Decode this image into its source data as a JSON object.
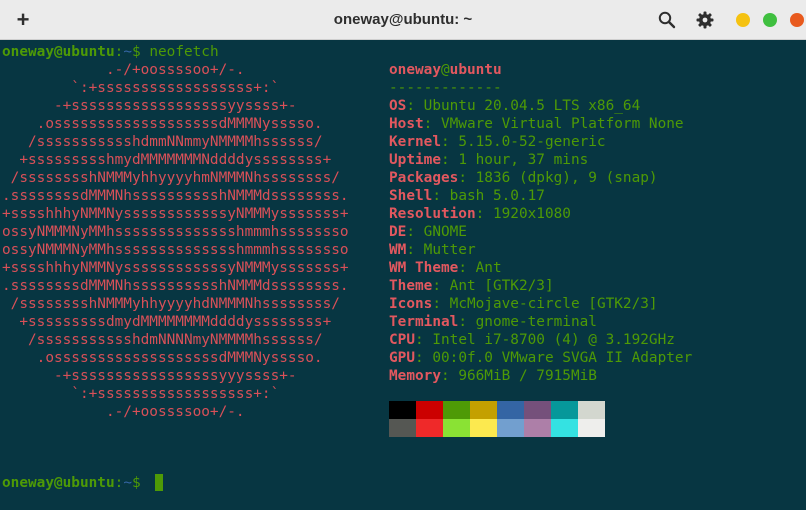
{
  "window": {
    "title": "oneway@ubuntu: ~",
    "new_tab": "+"
  },
  "colors": {
    "close": "#e85a1e",
    "maximize": "#3fbf3f",
    "minimize": "#f5c211",
    "background": "#073642"
  },
  "prompt": {
    "user_host": "oneway@ubuntu",
    "separator": ":",
    "path": "~",
    "symbol": "$",
    "command": "neofetch"
  },
  "logo": [
    "            .-/+oossssoo+/-.",
    "        `:+ssssssssssssssssss+:`",
    "      -+ssssssssssssssssssyyssss+-",
    "    .osssssssssssssssssssdMMMNysssso.",
    "   /ssssssssssshdmmNNmmyNMMMMhssssss/",
    "  +ssssssssshmydMMMMMMMNddddyssssssss+",
    " /sssssssshNMMMyhhyyyyhmNMMMNhssssssss/",
    ".ssssssssdMMMNhsssssssssshNMMMdssssssss.",
    "+sssshhhyNMMNyssssssssssssyNMMMysssssss+",
    "ossyNMMMNyMMhsssssssssssssshmmmhssssssso",
    "ossyNMMMNyMMhsssssssssssssshmmmhssssssso",
    "+sssshhhyNMMNyssssssssssssyNMMMysssssss+",
    ".ssssssssdMMMNhsssssssssshNMMMdssssssss.",
    " /sssssssshNMMMyhhyyyyhdNMMMNhssssssss/",
    "  +sssssssssdmydMMMMMMMMddddyssssssss+",
    "   /ssssssssssshdmNNNNmyNMMMMhssssss/",
    "    .osssssssssssssssssssdMMMNysssso.",
    "      -+sssssssssssssssssyyyssss+-",
    "        `:+ssssssssssssssssss+:`",
    "            .-/+oossssoo+/-."
  ],
  "info": {
    "user": "oneway",
    "at": "@",
    "host": "ubuntu",
    "underline": "-------------",
    "rows": [
      {
        "key": "OS",
        "value": "Ubuntu 20.04.5 LTS x86_64"
      },
      {
        "key": "Host",
        "value": "VMware Virtual Platform None"
      },
      {
        "key": "Kernel",
        "value": "5.15.0-52-generic"
      },
      {
        "key": "Uptime",
        "value": "1 hour, 37 mins"
      },
      {
        "key": "Packages",
        "value": "1836 (dpkg), 9 (snap)"
      },
      {
        "key": "Shell",
        "value": "bash 5.0.17"
      },
      {
        "key": "Resolution",
        "value": "1920x1080"
      },
      {
        "key": "DE",
        "value": "GNOME"
      },
      {
        "key": "WM",
        "value": "Mutter"
      },
      {
        "key": "WM Theme",
        "value": "Ant"
      },
      {
        "key": "Theme",
        "value": "Ant [GTK2/3]"
      },
      {
        "key": "Icons",
        "value": "McMojave-circle [GTK2/3]"
      },
      {
        "key": "Terminal",
        "value": "gnome-terminal"
      },
      {
        "key": "CPU",
        "value": "Intel i7-8700 (4) @ 3.192GHz"
      },
      {
        "key": "GPU",
        "value": "00:0f.0 VMware SVGA II Adapter"
      },
      {
        "key": "Memory",
        "value": "966MiB / 7915MiB"
      }
    ]
  },
  "palette": {
    "normal": [
      "#000000",
      "#cc0000",
      "#4e9a06",
      "#c4a000",
      "#3465a4",
      "#75507b",
      "#06989a",
      "#d3d7cf"
    ],
    "bright": [
      "#555753",
      "#ef2929",
      "#8ae234",
      "#fce94f",
      "#729fcf",
      "#ad7fa8",
      "#34e2e2",
      "#eeeeec"
    ]
  }
}
